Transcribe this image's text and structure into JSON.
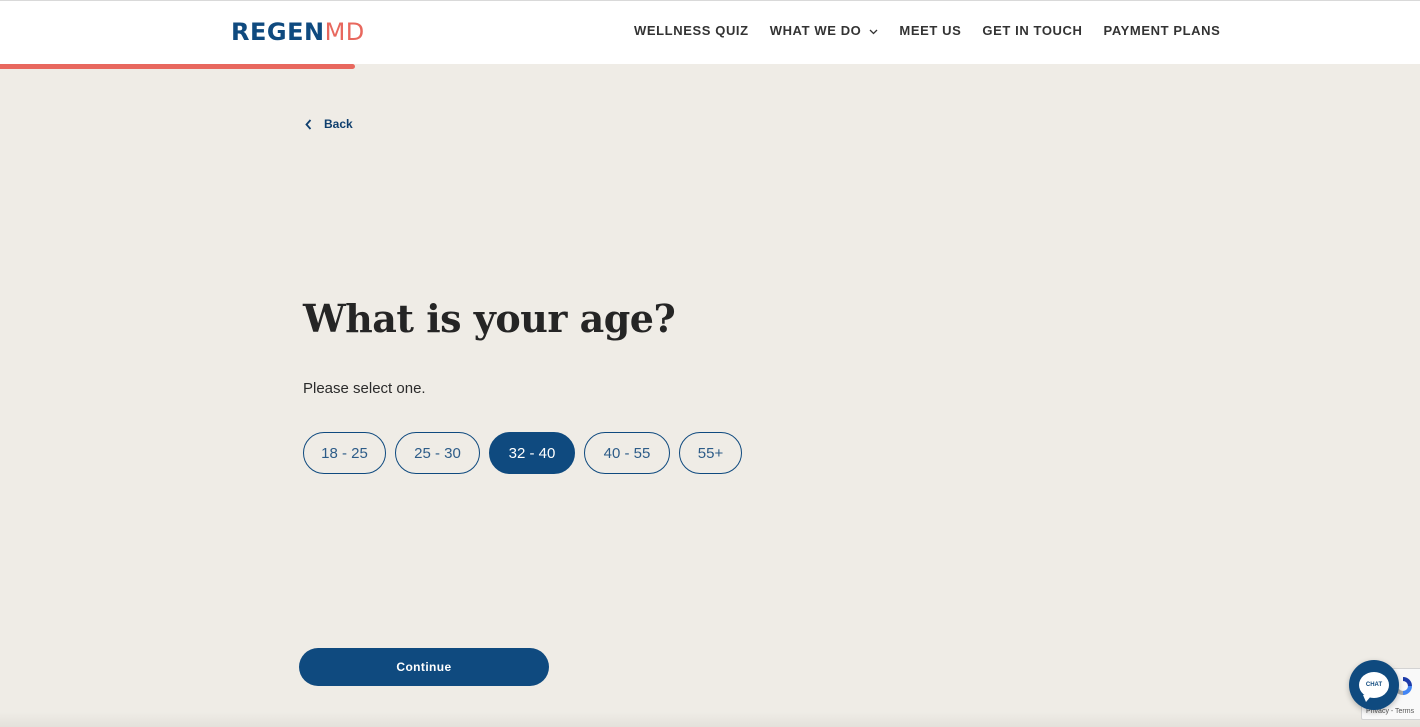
{
  "header": {
    "logo": {
      "part1": "REGEN",
      "part2": "MD"
    },
    "nav": [
      {
        "label": "WELLNESS QUIZ",
        "dropdown": false
      },
      {
        "label": "WHAT WE DO",
        "dropdown": true
      },
      {
        "label": "MEET US",
        "dropdown": false
      },
      {
        "label": "GET IN TOUCH",
        "dropdown": false
      },
      {
        "label": "PAYMENT PLANS",
        "dropdown": false
      }
    ]
  },
  "progress": {
    "fraction": 0.25,
    "color": "#e8685e"
  },
  "quiz": {
    "back_label": "Back",
    "question": "What is your age?",
    "instruction": "Please select one.",
    "options": [
      {
        "label": "18 - 25",
        "selected": false
      },
      {
        "label": "25 - 30",
        "selected": false
      },
      {
        "label": "32 - 40",
        "selected": true
      },
      {
        "label": "40 - 55",
        "selected": false
      },
      {
        "label": "55+",
        "selected": false
      }
    ],
    "continue_label": "Continue"
  },
  "widgets": {
    "chat_label": "CHAT",
    "recaptcha_text": "Privacy - Terms"
  },
  "colors": {
    "brand_blue": "#0f4a7f",
    "accent_coral": "#e8685e",
    "background": "#efece6"
  }
}
